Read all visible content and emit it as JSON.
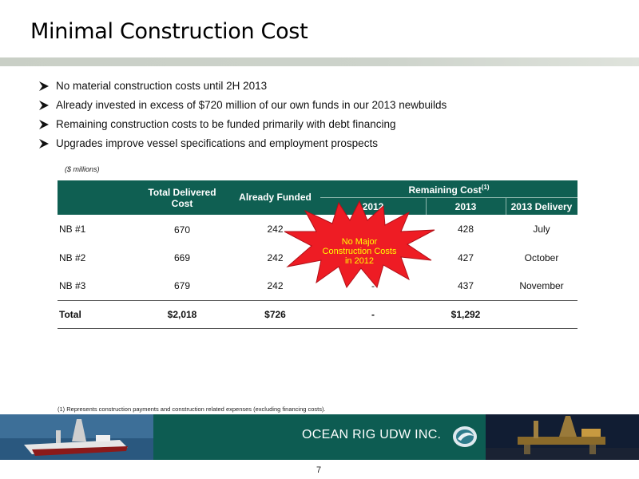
{
  "title": "Minimal Construction Cost",
  "bullets": [
    "No material construction costs until 2H 2013",
    "Already invested in excess of $720 million of our own funds in our 2013 newbuilds",
    "Remaining construction costs to be funded primarily with debt financing",
    "Upgrades improve vessel specifications and employment prospects"
  ],
  "units_note": "($ millions)",
  "table": {
    "headers": {
      "total_delivered_cost_line1": "Total Delivered",
      "total_delivered_cost_line2": "Cost",
      "already_funded": "Already Funded",
      "remaining_cost": "Remaining Cost",
      "remaining_cost_sup": "(1)",
      "col_2012": "2012",
      "col_2013": "2013",
      "col_2013_delivery": "2013 Delivery"
    },
    "rows": [
      {
        "label": "NB #1",
        "total_cost": "670",
        "already_funded": "242",
        "remaining_2012": "-",
        "remaining_2013": "428",
        "delivery_2013": "July"
      },
      {
        "label": "NB #2",
        "total_cost": "669",
        "already_funded": "242",
        "remaining_2012": "-",
        "remaining_2013": "427",
        "delivery_2013": "October"
      },
      {
        "label": "NB #3",
        "total_cost": "679",
        "already_funded": "242",
        "remaining_2012": "-",
        "remaining_2013": "437",
        "delivery_2013": "November"
      }
    ],
    "total": {
      "label": "Total",
      "total_cost": "$2,018",
      "already_funded": "$726",
      "remaining_2012": "-",
      "remaining_2013": "$1,292",
      "delivery_2013": ""
    }
  },
  "callout": {
    "line1": "No Major",
    "line2": "Construction Costs",
    "line3": "in 2012",
    "fill_color": "#ee1c24",
    "text_color": "#ffff00"
  },
  "footnote": "(1) Represents construction payments and construction related expenses (excluding  financing costs).",
  "footer": {
    "company": "OCEAN RIG UDW INC.",
    "band_color": "#0d5c52"
  },
  "page_number": "7"
}
